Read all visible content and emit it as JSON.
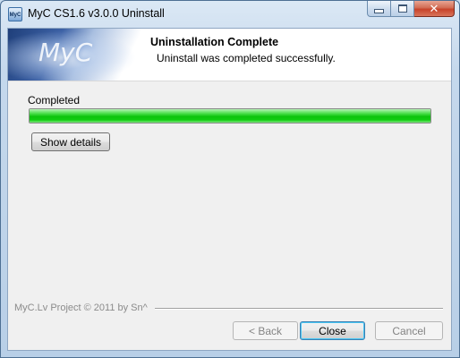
{
  "window": {
    "title": "MyC CS1.6 v3.0.0 Uninstall",
    "icon_label": "MyC",
    "controls": {
      "minimize": "minimize-icon",
      "maximize": "maximize-icon",
      "close": "✕"
    }
  },
  "header": {
    "banner_text": "MyC",
    "title": "Uninstallation Complete",
    "subtitle": "Uninstall was completed successfully."
  },
  "status": {
    "label": "Completed",
    "progress_fraction": 1.0,
    "progress_color": "#11cd11"
  },
  "buttons": {
    "show_details": "Show details",
    "back": "< Back",
    "close": "Close",
    "cancel": "Cancel"
  },
  "footer": {
    "branding": "MyC.Lv Project © 2011 by Sn^"
  }
}
